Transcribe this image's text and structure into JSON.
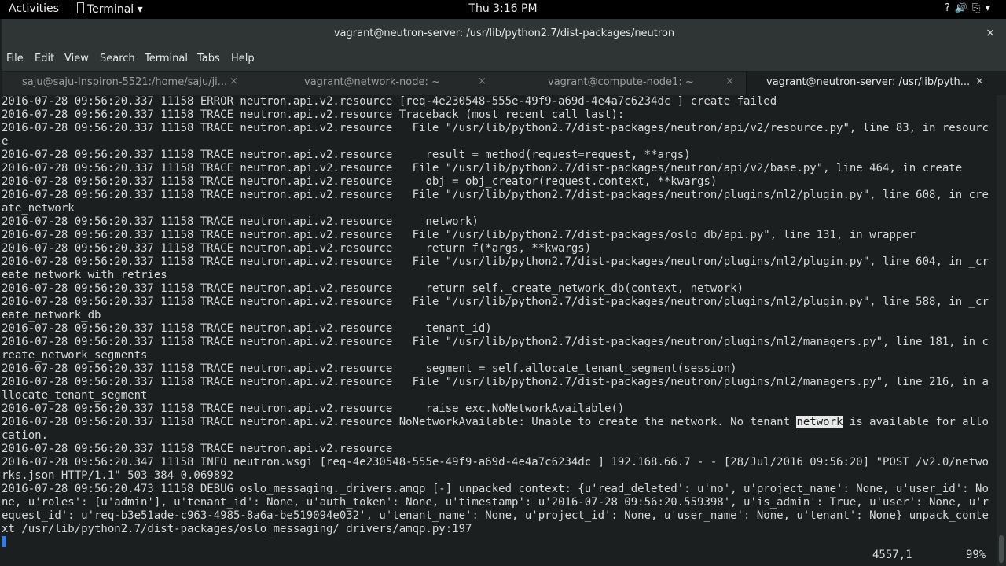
{
  "topbar": {
    "activities": "Activities",
    "app_name": "Terminal",
    "app_caret": "▾",
    "clock": "Thu  3:16 PM",
    "tray": "?🔊⎘▾"
  },
  "window": {
    "title": "vagrant@neutron-server: /usr/lib/python2.7/dist-packages/neutron",
    "close": "×"
  },
  "menu": [
    "File",
    "Edit",
    "View",
    "Search",
    "Terminal",
    "Tabs",
    "Help"
  ],
  "tabs": [
    {
      "label": "saju@saju-Inspiron-5521:/home/saju/ji...",
      "close": "×"
    },
    {
      "label": "vagrant@network-node: ~",
      "close": "×"
    },
    {
      "label": "vagrant@compute-node1: ~",
      "close": "×"
    },
    {
      "label": "vagrant@neutron-server: /usr/lib/pyth...",
      "close": "×"
    }
  ],
  "terminal": {
    "lines": [
      "2016-07-28 09:56:20.337 11158 ERROR neutron.api.v2.resource [req-4e230548-555e-49f9-a69d-4e4a7c6234dc ] create failed",
      "2016-07-28 09:56:20.337 11158 TRACE neutron.api.v2.resource Traceback (most recent call last):",
      "2016-07-28 09:56:20.337 11158 TRACE neutron.api.v2.resource   File \"/usr/lib/python2.7/dist-packages/neutron/api/v2/resource.py\", line 83, in resourc",
      "e",
      "2016-07-28 09:56:20.337 11158 TRACE neutron.api.v2.resource     result = method(request=request, **args)",
      "2016-07-28 09:56:20.337 11158 TRACE neutron.api.v2.resource   File \"/usr/lib/python2.7/dist-packages/neutron/api/v2/base.py\", line 464, in create",
      "2016-07-28 09:56:20.337 11158 TRACE neutron.api.v2.resource     obj = obj_creator(request.context, **kwargs)",
      "2016-07-28 09:56:20.337 11158 TRACE neutron.api.v2.resource   File \"/usr/lib/python2.7/dist-packages/neutron/plugins/ml2/plugin.py\", line 608, in cre",
      "ate_network",
      "2016-07-28 09:56:20.337 11158 TRACE neutron.api.v2.resource     network)",
      "2016-07-28 09:56:20.337 11158 TRACE neutron.api.v2.resource   File \"/usr/lib/python2.7/dist-packages/oslo_db/api.py\", line 131, in wrapper",
      "2016-07-28 09:56:20.337 11158 TRACE neutron.api.v2.resource     return f(*args, **kwargs)",
      "2016-07-28 09:56:20.337 11158 TRACE neutron.api.v2.resource   File \"/usr/lib/python2.7/dist-packages/neutron/plugins/ml2/plugin.py\", line 604, in _cr",
      "eate_network_with_retries",
      "2016-07-28 09:56:20.337 11158 TRACE neutron.api.v2.resource     return self._create_network_db(context, network)",
      "2016-07-28 09:56:20.337 11158 TRACE neutron.api.v2.resource   File \"/usr/lib/python2.7/dist-packages/neutron/plugins/ml2/plugin.py\", line 588, in _cr",
      "eate_network_db",
      "2016-07-28 09:56:20.337 11158 TRACE neutron.api.v2.resource     tenant_id)",
      "2016-07-28 09:56:20.337 11158 TRACE neutron.api.v2.resource   File \"/usr/lib/python2.7/dist-packages/neutron/plugins/ml2/managers.py\", line 181, in c",
      "reate_network_segments",
      "2016-07-28 09:56:20.337 11158 TRACE neutron.api.v2.resource     segment = self.allocate_tenant_segment(session)",
      "2016-07-28 09:56:20.337 11158 TRACE neutron.api.v2.resource   File \"/usr/lib/python2.7/dist-packages/neutron/plugins/ml2/managers.py\", line 216, in a",
      "llocate_tenant_segment",
      "2016-07-28 09:56:20.337 11158 TRACE neutron.api.v2.resource     raise exc.NoNetworkAvailable()",
      "2016-07-28 09:56:20.337 11158 TRACE neutron.api.v2.resource NoNetworkAvailable: Unable to create the network. No tenant network is available for allo",
      "cation.",
      "2016-07-28 09:56:20.337 11158 TRACE neutron.api.v2.resource",
      "2016-07-28 09:56:20.347 11158 INFO neutron.wsgi [req-4e230548-555e-49f9-a69d-4e4a7c6234dc ] 192.168.66.7 - - [28/Jul/2016 09:56:20] \"POST /v2.0/netwo",
      "rks.json HTTP/1.1\" 503 384 0.069892",
      "2016-07-28 09:56:20.473 11158 DEBUG oslo_messaging._drivers.amqp [-] unpacked context: {u'read_deleted': u'no', u'project_name': None, u'user_id': No",
      "ne, u'roles': [u'admin'], u'tenant_id': None, u'auth_token': None, u'timestamp': u'2016-07-28 09:56:20.559398', u'is_admin': True, u'user': None, u'r",
      "equest_id': u'req-b3e51ade-c963-4985-8a6a-be519094e032', u'tenant_name': None, u'project_id': None, u'user_name': None, u'tenant': None} unpack_conte",
      "xt /usr/lib/python2.7/dist-packages/oslo_messaging/_drivers/amqp.py:197"
    ],
    "highlight_word": "network",
    "status_position": "4557,1",
    "status_percent": "99%"
  }
}
